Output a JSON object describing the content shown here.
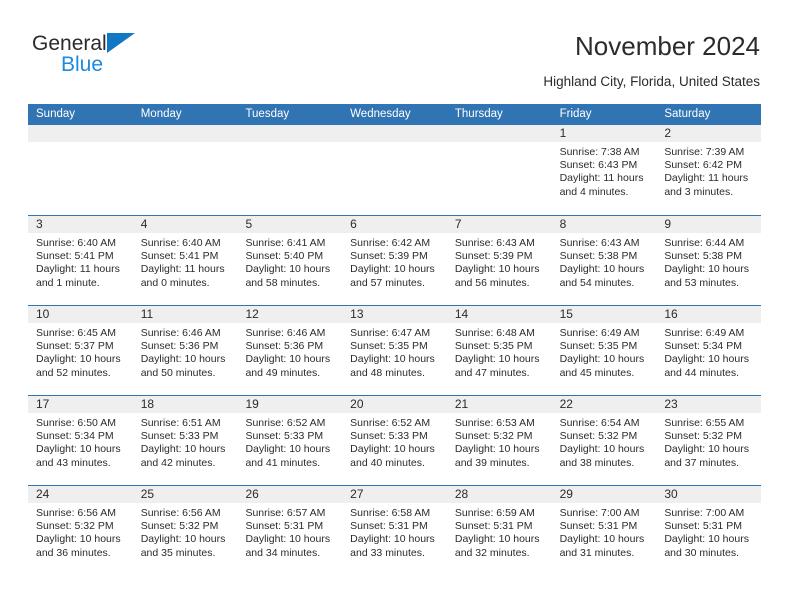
{
  "brand": {
    "name_top": "General",
    "name_bottom": "Blue",
    "triangle_color": "#1176c4",
    "blue_text_color": "#1c8ae0"
  },
  "header": {
    "title": "November 2024",
    "subtitle": "Highland City, Florida, United States"
  },
  "theme": {
    "header_blue": "#3074b4",
    "date_band_gray": "#efeff0",
    "text_color": "#2b2b2b"
  },
  "weekday_headers": [
    "Sunday",
    "Monday",
    "Tuesday",
    "Wednesday",
    "Thursday",
    "Friday",
    "Saturday"
  ],
  "weeks": [
    [
      {
        "date": "",
        "empty": true
      },
      {
        "date": "",
        "empty": true
      },
      {
        "date": "",
        "empty": true
      },
      {
        "date": "",
        "empty": true
      },
      {
        "date": "",
        "empty": true
      },
      {
        "date": "1",
        "sunrise": "Sunrise: 7:38 AM",
        "sunset": "Sunset: 6:43 PM",
        "daylight_1": "Daylight: 11 hours",
        "daylight_2": "and 4 minutes."
      },
      {
        "date": "2",
        "sunrise": "Sunrise: 7:39 AM",
        "sunset": "Sunset: 6:42 PM",
        "daylight_1": "Daylight: 11 hours",
        "daylight_2": "and 3 minutes."
      }
    ],
    [
      {
        "date": "3",
        "sunrise": "Sunrise: 6:40 AM",
        "sunset": "Sunset: 5:41 PM",
        "daylight_1": "Daylight: 11 hours",
        "daylight_2": "and 1 minute."
      },
      {
        "date": "4",
        "sunrise": "Sunrise: 6:40 AM",
        "sunset": "Sunset: 5:41 PM",
        "daylight_1": "Daylight: 11 hours",
        "daylight_2": "and 0 minutes."
      },
      {
        "date": "5",
        "sunrise": "Sunrise: 6:41 AM",
        "sunset": "Sunset: 5:40 PM",
        "daylight_1": "Daylight: 10 hours",
        "daylight_2": "and 58 minutes."
      },
      {
        "date": "6",
        "sunrise": "Sunrise: 6:42 AM",
        "sunset": "Sunset: 5:39 PM",
        "daylight_1": "Daylight: 10 hours",
        "daylight_2": "and 57 minutes."
      },
      {
        "date": "7",
        "sunrise": "Sunrise: 6:43 AM",
        "sunset": "Sunset: 5:39 PM",
        "daylight_1": "Daylight: 10 hours",
        "daylight_2": "and 56 minutes."
      },
      {
        "date": "8",
        "sunrise": "Sunrise: 6:43 AM",
        "sunset": "Sunset: 5:38 PM",
        "daylight_1": "Daylight: 10 hours",
        "daylight_2": "and 54 minutes."
      },
      {
        "date": "9",
        "sunrise": "Sunrise: 6:44 AM",
        "sunset": "Sunset: 5:38 PM",
        "daylight_1": "Daylight: 10 hours",
        "daylight_2": "and 53 minutes."
      }
    ],
    [
      {
        "date": "10",
        "sunrise": "Sunrise: 6:45 AM",
        "sunset": "Sunset: 5:37 PM",
        "daylight_1": "Daylight: 10 hours",
        "daylight_2": "and 52 minutes."
      },
      {
        "date": "11",
        "sunrise": "Sunrise: 6:46 AM",
        "sunset": "Sunset: 5:36 PM",
        "daylight_1": "Daylight: 10 hours",
        "daylight_2": "and 50 minutes."
      },
      {
        "date": "12",
        "sunrise": "Sunrise: 6:46 AM",
        "sunset": "Sunset: 5:36 PM",
        "daylight_1": "Daylight: 10 hours",
        "daylight_2": "and 49 minutes."
      },
      {
        "date": "13",
        "sunrise": "Sunrise: 6:47 AM",
        "sunset": "Sunset: 5:35 PM",
        "daylight_1": "Daylight: 10 hours",
        "daylight_2": "and 48 minutes."
      },
      {
        "date": "14",
        "sunrise": "Sunrise: 6:48 AM",
        "sunset": "Sunset: 5:35 PM",
        "daylight_1": "Daylight: 10 hours",
        "daylight_2": "and 47 minutes."
      },
      {
        "date": "15",
        "sunrise": "Sunrise: 6:49 AM",
        "sunset": "Sunset: 5:35 PM",
        "daylight_1": "Daylight: 10 hours",
        "daylight_2": "and 45 minutes."
      },
      {
        "date": "16",
        "sunrise": "Sunrise: 6:49 AM",
        "sunset": "Sunset: 5:34 PM",
        "daylight_1": "Daylight: 10 hours",
        "daylight_2": "and 44 minutes."
      }
    ],
    [
      {
        "date": "17",
        "sunrise": "Sunrise: 6:50 AM",
        "sunset": "Sunset: 5:34 PM",
        "daylight_1": "Daylight: 10 hours",
        "daylight_2": "and 43 minutes."
      },
      {
        "date": "18",
        "sunrise": "Sunrise: 6:51 AM",
        "sunset": "Sunset: 5:33 PM",
        "daylight_1": "Daylight: 10 hours",
        "daylight_2": "and 42 minutes."
      },
      {
        "date": "19",
        "sunrise": "Sunrise: 6:52 AM",
        "sunset": "Sunset: 5:33 PM",
        "daylight_1": "Daylight: 10 hours",
        "daylight_2": "and 41 minutes."
      },
      {
        "date": "20",
        "sunrise": "Sunrise: 6:52 AM",
        "sunset": "Sunset: 5:33 PM",
        "daylight_1": "Daylight: 10 hours",
        "daylight_2": "and 40 minutes."
      },
      {
        "date": "21",
        "sunrise": "Sunrise: 6:53 AM",
        "sunset": "Sunset: 5:32 PM",
        "daylight_1": "Daylight: 10 hours",
        "daylight_2": "and 39 minutes."
      },
      {
        "date": "22",
        "sunrise": "Sunrise: 6:54 AM",
        "sunset": "Sunset: 5:32 PM",
        "daylight_1": "Daylight: 10 hours",
        "daylight_2": "and 38 minutes."
      },
      {
        "date": "23",
        "sunrise": "Sunrise: 6:55 AM",
        "sunset": "Sunset: 5:32 PM",
        "daylight_1": "Daylight: 10 hours",
        "daylight_2": "and 37 minutes."
      }
    ],
    [
      {
        "date": "24",
        "sunrise": "Sunrise: 6:56 AM",
        "sunset": "Sunset: 5:32 PM",
        "daylight_1": "Daylight: 10 hours",
        "daylight_2": "and 36 minutes."
      },
      {
        "date": "25",
        "sunrise": "Sunrise: 6:56 AM",
        "sunset": "Sunset: 5:32 PM",
        "daylight_1": "Daylight: 10 hours",
        "daylight_2": "and 35 minutes."
      },
      {
        "date": "26",
        "sunrise": "Sunrise: 6:57 AM",
        "sunset": "Sunset: 5:31 PM",
        "daylight_1": "Daylight: 10 hours",
        "daylight_2": "and 34 minutes."
      },
      {
        "date": "27",
        "sunrise": "Sunrise: 6:58 AM",
        "sunset": "Sunset: 5:31 PM",
        "daylight_1": "Daylight: 10 hours",
        "daylight_2": "and 33 minutes."
      },
      {
        "date": "28",
        "sunrise": "Sunrise: 6:59 AM",
        "sunset": "Sunset: 5:31 PM",
        "daylight_1": "Daylight: 10 hours",
        "daylight_2": "and 32 minutes."
      },
      {
        "date": "29",
        "sunrise": "Sunrise: 7:00 AM",
        "sunset": "Sunset: 5:31 PM",
        "daylight_1": "Daylight: 10 hours",
        "daylight_2": "and 31 minutes."
      },
      {
        "date": "30",
        "sunrise": "Sunrise: 7:00 AM",
        "sunset": "Sunset: 5:31 PM",
        "daylight_1": "Daylight: 10 hours",
        "daylight_2": "and 30 minutes."
      }
    ]
  ]
}
